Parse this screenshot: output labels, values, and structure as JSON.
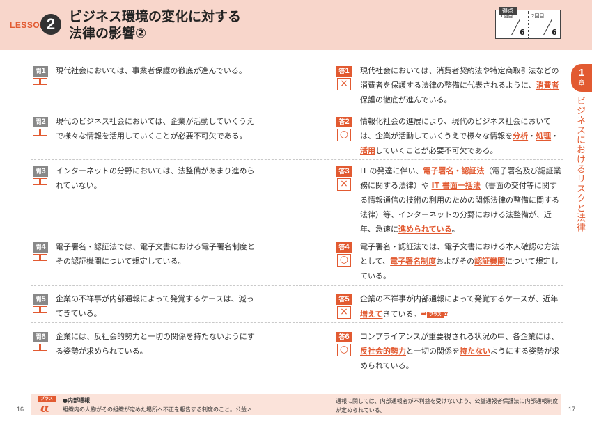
{
  "header": {
    "lesson_label": "LESSON",
    "lesson_number": "2",
    "title_line1": "ビジネス環境の変化に対する",
    "title_line2": "法律の影響②",
    "score": {
      "label": "得点",
      "attempt1_label": "1回目",
      "attempt2_label": "2回目",
      "attempt1_total": "6",
      "attempt2_total": "6"
    }
  },
  "chapter": {
    "number": "1",
    "unit": "章",
    "title": "ビジネスにおけるリスクと法律"
  },
  "questions": [
    {
      "q_label": "問",
      "q_num": "1",
      "question": "現代社会においては、事業者保護の徹底が進んでいる。",
      "a_label": "答",
      "a_num": "1",
      "mark": "×",
      "answer": [
        {
          "t": "現代社会においては、消費者契約法や特定商取引法などの消費者を保護する法律の整備に代表されるように、"
        },
        {
          "t": "消費者",
          "hl": true
        },
        {
          "t": "保護の徹底が進んでいる。"
        }
      ]
    },
    {
      "q_label": "問",
      "q_num": "2",
      "question": "現代のビジネス社会においては、企業が活動していくうえで様々な情報を活用していくことが必要不可欠である。",
      "a_label": "答",
      "a_num": "2",
      "mark": "○",
      "answer": [
        {
          "t": "情報化社会の進展により、現代のビジネス社会においては、企業が活動していくうえで様々な情報を"
        },
        {
          "t": "分析",
          "hl": true
        },
        {
          "t": "・"
        },
        {
          "t": "処理",
          "hl": true
        },
        {
          "t": "・"
        },
        {
          "t": "活用",
          "hl": true
        },
        {
          "t": "していくことが必要不可欠である。"
        }
      ]
    },
    {
      "q_label": "問",
      "q_num": "3",
      "question": "インターネットの分野においては、法整備があまり進められていない。",
      "a_label": "答",
      "a_num": "3",
      "mark": "×",
      "answer": [
        {
          "t": "IT の発達に伴い、"
        },
        {
          "t": "電子署名・認証法",
          "hl": true
        },
        {
          "t": "（電子署名及び認証業務に関する法律）や "
        },
        {
          "t": "IT 書面一括法",
          "hl": true
        },
        {
          "t": "（書面の交付等に関する情報通信の技術の利用のための関係法律の整備に関する法律）等、インターネットの分野における法整備が、近年、急速に"
        },
        {
          "t": "進められている",
          "hl": true
        },
        {
          "t": "。"
        }
      ]
    },
    {
      "q_label": "問",
      "q_num": "4",
      "question": "電子署名・認証法では、電子文書における電子署名制度とその認証機関について規定している。",
      "a_label": "答",
      "a_num": "4",
      "mark": "○",
      "answer": [
        {
          "t": "電子署名・認証法では、電子文書における本人確認の方法として、"
        },
        {
          "t": "電子署名制度",
          "hl": true
        },
        {
          "t": "およびその"
        },
        {
          "t": "認証機関",
          "hl": true
        },
        {
          "t": "について規定している。"
        }
      ]
    },
    {
      "q_label": "問",
      "q_num": "5",
      "question": "企業の不祥事が内部通報によって発覚するケースは、減ってきている。",
      "a_label": "答",
      "a_num": "5",
      "mark": "×",
      "answer": [
        {
          "t": "企業の不祥事が内部通報によって発覚するケースが、近年"
        },
        {
          "t": "増えて",
          "hl": true
        },
        {
          "t": "きている。"
        }
      ],
      "plus_ref": {
        "arrow": "➡",
        "tag": "プラス",
        "alpha": "α"
      }
    },
    {
      "q_label": "問",
      "q_num": "6",
      "question": "企業には、反社会的勢力と一切の関係を持たないようにする姿勢が求められている。",
      "a_label": "答",
      "a_num": "6",
      "mark": "○",
      "answer": [
        {
          "t": "コンプライアンスが重要視される状況の中、各企業には、"
        },
        {
          "t": "反社会的勢力",
          "hl": true
        },
        {
          "t": "と一切の関係を"
        },
        {
          "t": "持たない",
          "hl": true
        },
        {
          "t": "ようにする姿勢が求められている。"
        }
      ]
    }
  ],
  "footer": {
    "plus_tag": "プラス",
    "plus_alpha": "α",
    "heading": "●内部通報",
    "left_text": "組織内の人物がその組織が定めた場所へ不正を報告する制度のこと。公益↗",
    "right_text": "通報に関しては、内部通報者が不利益を受けないよう、公益通報者保護法に内部通報制度が定められている。"
  },
  "pages": {
    "left": "16",
    "right": "17"
  },
  "colors": {
    "accent": "#e25a31",
    "header_bg": "#f8d6cb",
    "footer_bg": "#fbe3da",
    "q_badge": "#888888"
  }
}
